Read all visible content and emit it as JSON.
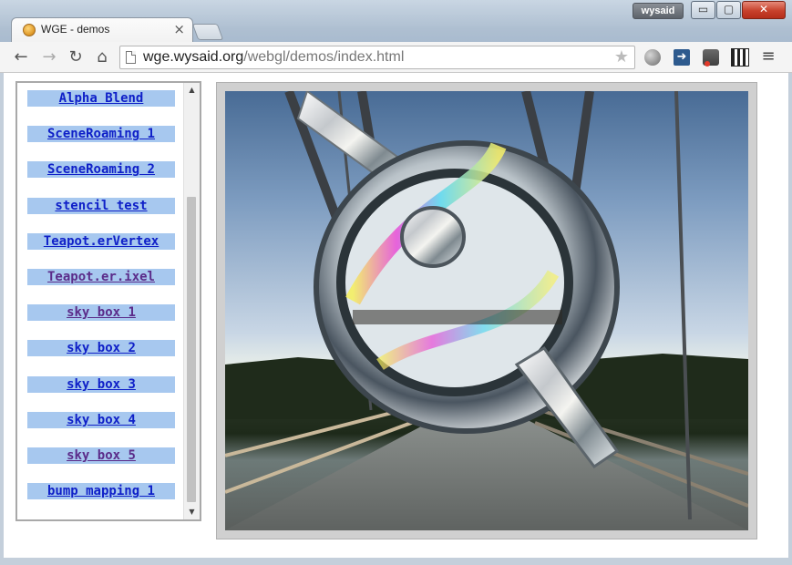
{
  "browser": {
    "tab_title": "WGE - demos",
    "tab_close": "×",
    "user_badge": "wysaid",
    "window_controls": {
      "minimize": "▭",
      "maximize": "▢",
      "close": "✕"
    },
    "nav": {
      "back": "←",
      "forward": "→",
      "reload": "↻",
      "home": "⌂",
      "star": "★",
      "menu": "≡",
      "ext_arrow": "➜"
    },
    "url": {
      "host": "wge.wysaid.org",
      "path": "/webgl/demos/index.html"
    },
    "icons": [
      "page-icon",
      "star-icon",
      "globe-icon",
      "arrow-icon",
      "extension-icon",
      "qr-icon",
      "menu-icon"
    ]
  },
  "demos": {
    "items": [
      {
        "label": "Alpha Blend",
        "visited": false
      },
      {
        "label": "SceneRoaming 1",
        "visited": false
      },
      {
        "label": "SceneRoaming 2",
        "visited": false
      },
      {
        "label": "stencil test",
        "visited": false
      },
      {
        "label": "Teapot.erVertex",
        "visited": false
      },
      {
        "label": "Teapot.er.ixel",
        "visited": true
      },
      {
        "label": "sky box 1",
        "visited": true
      },
      {
        "label": "sky box 2",
        "visited": false
      },
      {
        "label": "sky box 3",
        "visited": false
      },
      {
        "label": "sky box 4",
        "visited": false
      },
      {
        "label": "sky box 5",
        "visited": true
      },
      {
        "label": "bump mapping 1",
        "visited": false
      }
    ],
    "scroll": {
      "up": "▲",
      "down": "▼"
    }
  },
  "colors": {
    "link": "#0f20c8",
    "visited_link": "#5b2c8a",
    "item_bg": "#a7c8ef"
  }
}
